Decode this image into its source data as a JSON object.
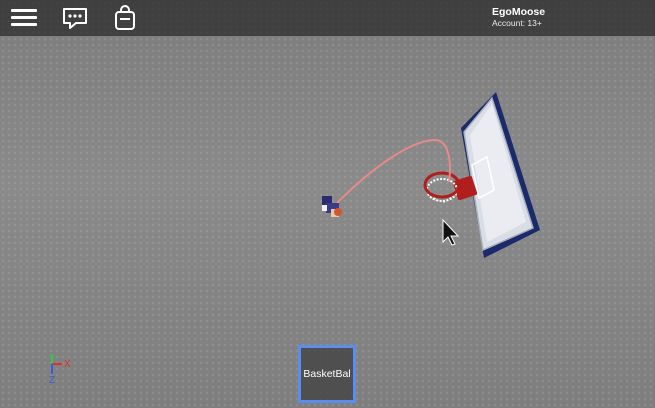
{
  "topbar": {
    "menu_icon": "hamburger-menu-icon",
    "chat_icon": "chat-bubble-icon",
    "backpack_icon": "backpack-icon",
    "username": "EgoMoose",
    "account": "Account: 13+"
  },
  "hotbar": {
    "slot_label": "BasketBal"
  },
  "gizmo": {
    "x_label": "X",
    "z_label": "Z"
  },
  "colors": {
    "hotbar_border": "#5a8dee",
    "trajectory": "#f08a8a",
    "hoop_rim": "#b01e1e",
    "backboard_frame": "#1b2a6b"
  }
}
